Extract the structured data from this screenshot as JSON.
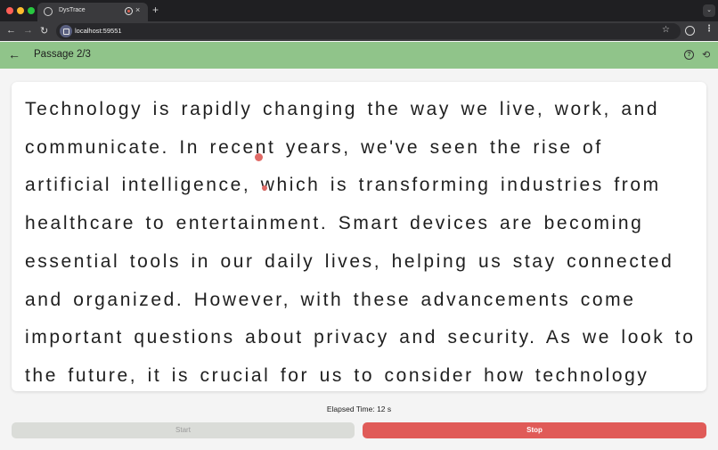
{
  "browser": {
    "tab_title": "DysTrace",
    "tab_close": "×",
    "new_tab": "+",
    "tab_search": "⌄",
    "url": "localhost:59551",
    "back": "←",
    "forward": "→",
    "reload": "↻",
    "bookmark": "☆",
    "menu": "⋮"
  },
  "appbar": {
    "back_icon": "←",
    "title": "Passage 2/3",
    "help_icon": "?",
    "history_icon": "⟲"
  },
  "passage": {
    "text": "Technology is rapidly changing the way we live, work, and communicate. In recent years, we've seen the rise of artificial intelligence, which is transforming industries from healthcare to entertainment. Smart devices are becoming essential tools in our daily lives, helping us stay connected and organized. However, with these advancements come important questions about privacy and security. As we look to the future, it is crucial for us to consider how technology"
  },
  "status": {
    "elapsed": "Elapsed Time: 12 s"
  },
  "controls": {
    "start_label": "Start",
    "stop_label": "Stop"
  },
  "colors": {
    "appbar": "#90c48a",
    "stop_button": "#e05b58",
    "gaze_dot": "#e06a66"
  }
}
